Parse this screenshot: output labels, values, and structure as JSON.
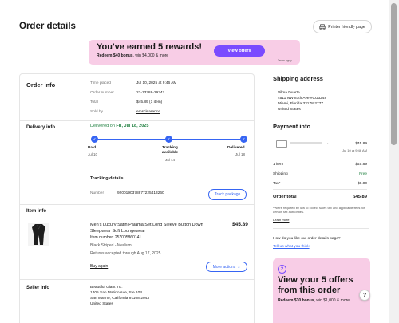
{
  "page": {
    "title": "Order details",
    "print_label": "Printer friendly page"
  },
  "promo": {
    "title": "You've earned 5 rewards!",
    "sub_bold": "Redeem $40 bonus",
    "sub_rest": ", win $4,000 & more",
    "button": "View offers",
    "terms": "Terms apply"
  },
  "order_info": {
    "title": "Order info",
    "rows": [
      {
        "label": "Time placed",
        "value": "Jul 10, 2025 at 9:46 AM"
      },
      {
        "label": "Order number",
        "value": "23-13288-29347"
      },
      {
        "label": "Total",
        "value": "$45.89 (1 item)"
      },
      {
        "label": "Sold by",
        "value": "emsclearance"
      }
    ]
  },
  "delivery": {
    "title": "Delivery info",
    "status_prefix": "Delivered on",
    "status_date": "Fri, Jul 18, 2025",
    "steps": [
      {
        "label": "Paid",
        "date": "Jul 10"
      },
      {
        "label": "Tracking available",
        "date": "Jul 14"
      },
      {
        "label": "Delivered",
        "date": "Jul 18"
      }
    ],
    "tracking_title": "Tracking details",
    "number_label": "Number",
    "number_value": "9200190378877225413260",
    "track_button": "Track package"
  },
  "item": {
    "section_title": "Item info",
    "title": "Men's Luxury Satin Pajama Set Long Sleeve Button Down Sleepwear Soft Loungewear",
    "price": "$45.89",
    "item_number": "Item number: 257005860141",
    "variant": "Black Striped - Medium",
    "returns": "Returns accepted through Aug 17, 2025.",
    "buy_again": "Buy again",
    "more_actions": "More actions"
  },
  "seller": {
    "title": "Seller info",
    "lines": [
      "Beautiful Giant Inc.",
      "1405 San Marino Ave, Ste 104",
      "San Marino, California 91108-2043",
      "United States"
    ]
  },
  "shipping": {
    "title": "Shipping address",
    "lines": [
      "Vilma Duarte",
      "4511 NW 87th Ave #CU3248",
      "Miami, Florida 33178-2777",
      "United States"
    ]
  },
  "payment": {
    "title": "Payment info",
    "card_amount": "$45.89",
    "card_date": "Jul 10 at 9:46 AM",
    "rows": [
      {
        "label": "1 item",
        "value": "$45.89"
      },
      {
        "label": "Shipping",
        "value": "Free"
      },
      {
        "label": "Tax*",
        "value": "$0.00"
      }
    ],
    "total_label": "Order total",
    "total_value": "$45.89",
    "note": "*We're required by law to collect sales tax and applicable fees for certain tax authorities.",
    "learn_more": "Learn more"
  },
  "feedback": {
    "question": "How do you like our order details page?",
    "link": "Tell us what you think"
  },
  "promo2": {
    "badge": "2",
    "title": "View your 5 offers from this order",
    "sub_bold": "Redeem $30 bonus",
    "sub_rest": ", win $1,000 & more"
  },
  "help": {
    "label": "?"
  }
}
